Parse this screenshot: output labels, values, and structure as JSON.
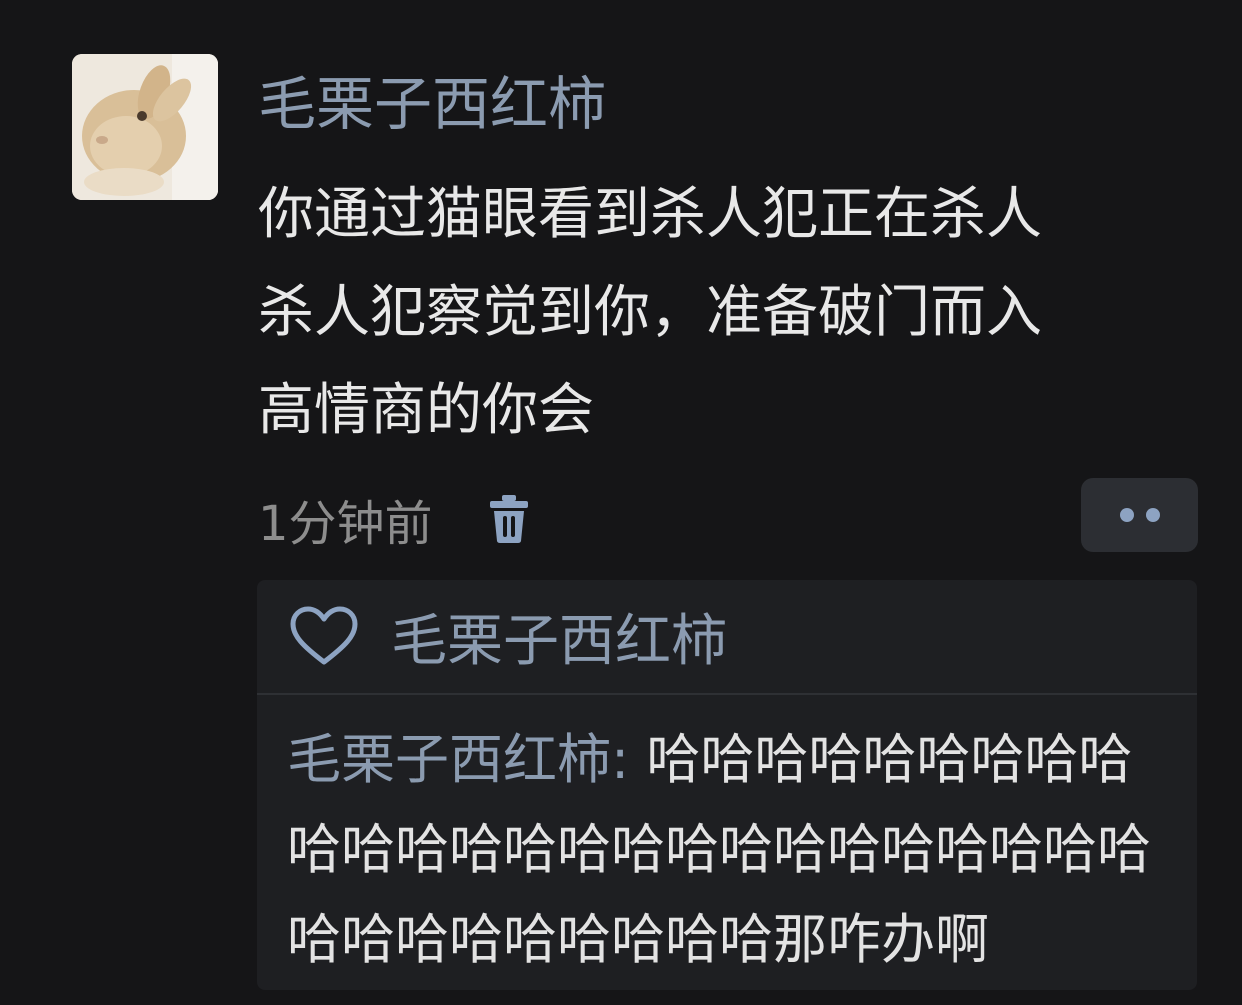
{
  "post": {
    "author": "毛栗子西红柿",
    "avatar_icon": "rabbit-avatar",
    "lines": [
      "你通过猫眼看到杀人犯正在杀人",
      "杀人犯察觉到你，准备破门而入",
      "高情商的你会"
    ],
    "timestamp": "1分钟前",
    "delete_icon": "trash-icon",
    "more_icon": "more-dots-icon"
  },
  "likes": {
    "icon": "heart-icon",
    "names": "毛栗子西红柿"
  },
  "reply": {
    "author": "毛栗子西红柿:",
    "lines": [
      " 哈哈哈哈哈哈哈哈哈",
      "哈哈哈哈哈哈哈哈哈哈哈哈哈哈哈哈",
      "哈哈哈哈哈哈哈哈哈那咋办啊"
    ]
  },
  "colors": {
    "background": "#151517",
    "accent_name": "#8b9bb0",
    "icon_blue": "#8da3c2",
    "panel": "#1e1f22"
  }
}
